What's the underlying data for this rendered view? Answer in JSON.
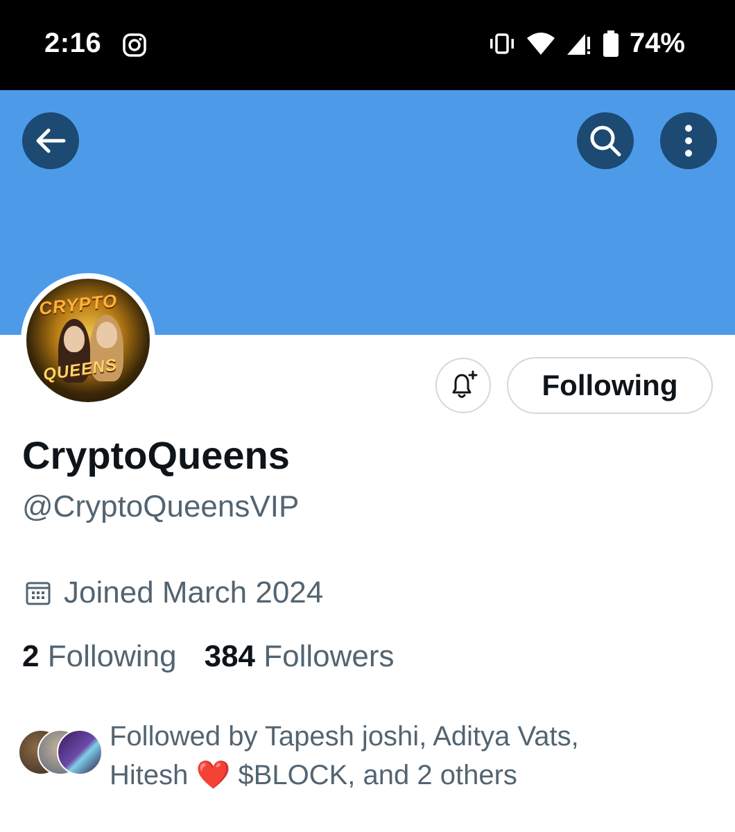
{
  "status_bar": {
    "time": "2:16",
    "battery": "74%",
    "icons": [
      "instagram-icon",
      "vibrate-icon",
      "wifi-icon",
      "signal-icon",
      "battery-icon"
    ]
  },
  "header": {
    "banner_color": "#4d9be8",
    "back_icon": "back-arrow-icon",
    "search_icon": "search-icon",
    "more_icon": "more-vertical-icon"
  },
  "avatar": {
    "title_top": "CRYPTO",
    "title_bottom": "QUEENS"
  },
  "actions": {
    "notify_icon": "bell-plus-icon",
    "following_label": "Following"
  },
  "profile": {
    "display_name": "CryptoQueens",
    "handle": "@CryptoQueensVIP",
    "joined": "Joined March 2024",
    "following_count": "2",
    "following_label": "Following",
    "followers_count": "384",
    "followers_label": "Followers"
  },
  "followed_by": {
    "line1": "Followed by Tapesh joshi, Aditya Vats,",
    "line2_a": "Hitesh",
    "emoji": "❤️",
    "line2_b": "$BLOCK, and 2 others"
  }
}
